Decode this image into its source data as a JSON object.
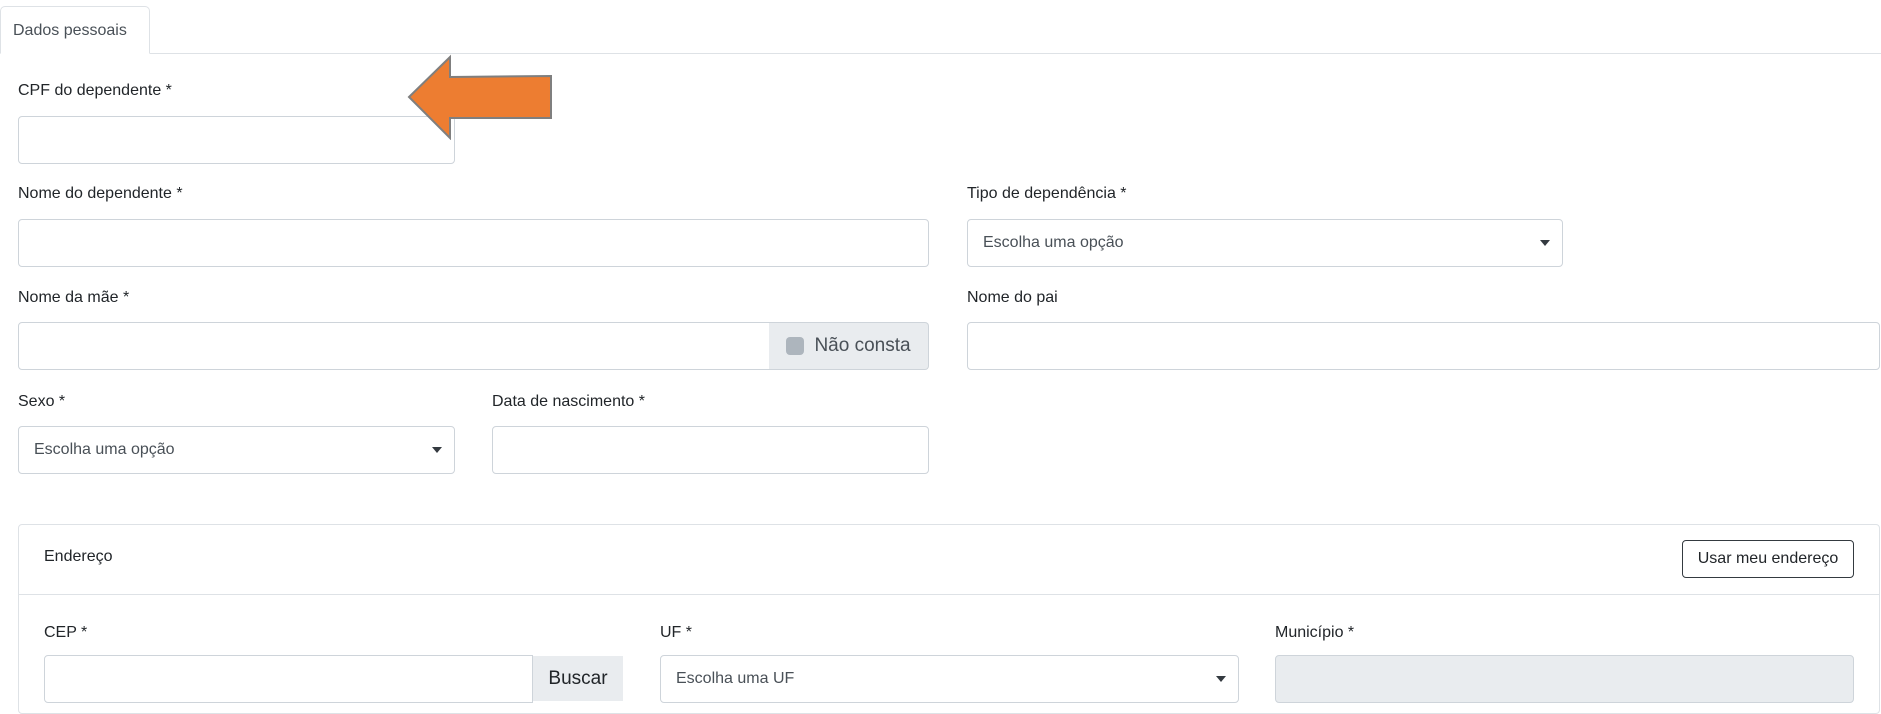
{
  "tabs": [
    {
      "label": "Dados pessoais",
      "active": true
    }
  ],
  "form": {
    "cpf": {
      "label": "CPF do dependente *",
      "value": "",
      "placeholder": ""
    },
    "nome": {
      "label": "Nome do dependente *",
      "value": "",
      "placeholder": ""
    },
    "tipo_dependencia": {
      "label": "Tipo de dependência *",
      "selected": "Escolha uma opção"
    },
    "nome_mae": {
      "label": "Nome da mãe *",
      "value": "",
      "placeholder": "",
      "nao_consta_label": "Não consta"
    },
    "nome_pai": {
      "label": "Nome do pai",
      "value": "",
      "placeholder": ""
    },
    "sexo": {
      "label": "Sexo *",
      "selected": "Escolha uma opção"
    },
    "data_nascimento": {
      "label": "Data de nascimento *",
      "value": "",
      "placeholder": ""
    }
  },
  "endereco": {
    "title": "Endereço",
    "usar_meu_endereco_label": "Usar meu endereço",
    "cep": {
      "label": "CEP *",
      "value": "",
      "placeholder": "",
      "buscar_label": "Buscar"
    },
    "uf": {
      "label": "UF *",
      "selected": "Escolha uma UF"
    },
    "municipio": {
      "label": "Município *",
      "value": ""
    }
  },
  "annotation": {
    "arrow_color": "#ED7D31",
    "arrow_border_color": "#7F7F7F",
    "points_to": "cpf-field"
  },
  "colors": {
    "border": "#ced4da",
    "addon_bg": "#e9ecef",
    "text": "#212529"
  }
}
